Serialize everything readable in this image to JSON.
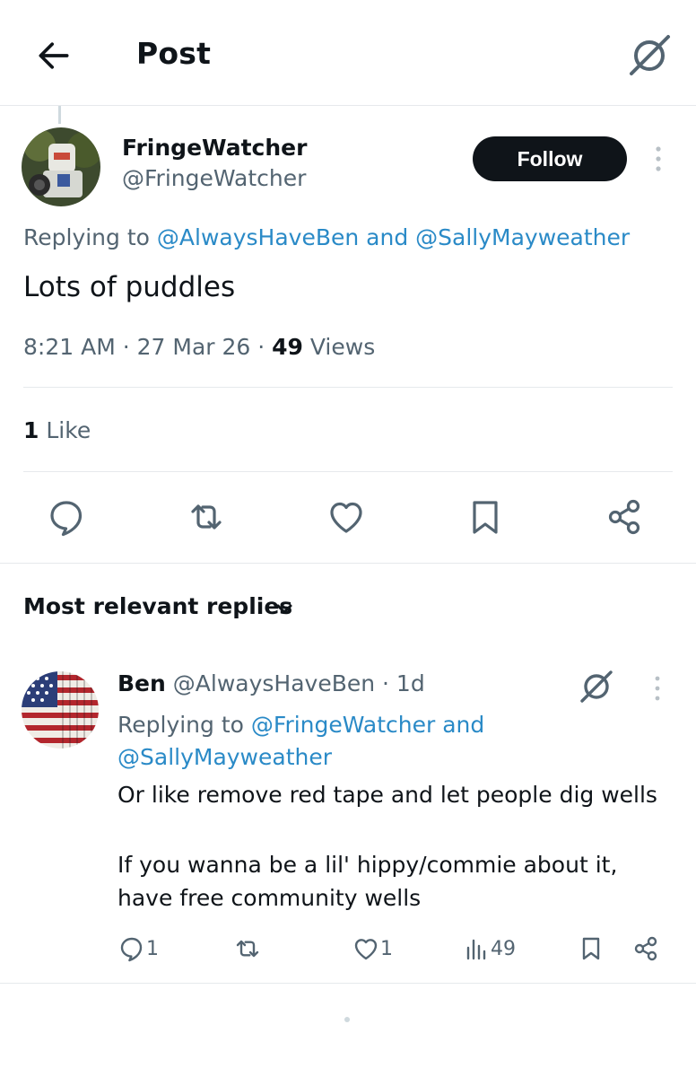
{
  "header": {
    "title": "Post",
    "back_icon": "arrow-left-icon",
    "grok_icon": "grok-icon"
  },
  "post": {
    "author_name": "FringeWatcher",
    "author_handle": "@FringeWatcher",
    "follow_label": "Follow",
    "replying_prefix": "Replying to ",
    "replying_user1": "@AlwaysHaveBen",
    "replying_and": " and ",
    "replying_user2": "@SallyMayweather",
    "text": "Lots of puddles",
    "time": "8:21 AM",
    "sep1": " · ",
    "date": "27 Mar 26",
    "sep2": " · ",
    "views_count": "49",
    "views_label": " Views",
    "likes_count": "1",
    "likes_label": " Like"
  },
  "replies_section": {
    "title": "Most relevant replies"
  },
  "reply": {
    "author_name": "Ben",
    "author_handle": "@AlwaysHaveBen",
    "sep": " · ",
    "age": "1d",
    "replying_prefix": "Replying to ",
    "replying_user1": "@FringeWatcher",
    "replying_and": " and",
    "replying_user2": "@SallyMayweather",
    "text_line1": "Or like remove red tape and let people dig wells",
    "text_line2": "If you wanna be a lil' hippy/commie about it,",
    "text_line3": "have free community wells",
    "reply_count": "1",
    "like_count": "1",
    "view_count": "49"
  },
  "colors": {
    "link": "#2a8ac7",
    "follow_bg": "#0f1419",
    "muted": "#536471"
  }
}
